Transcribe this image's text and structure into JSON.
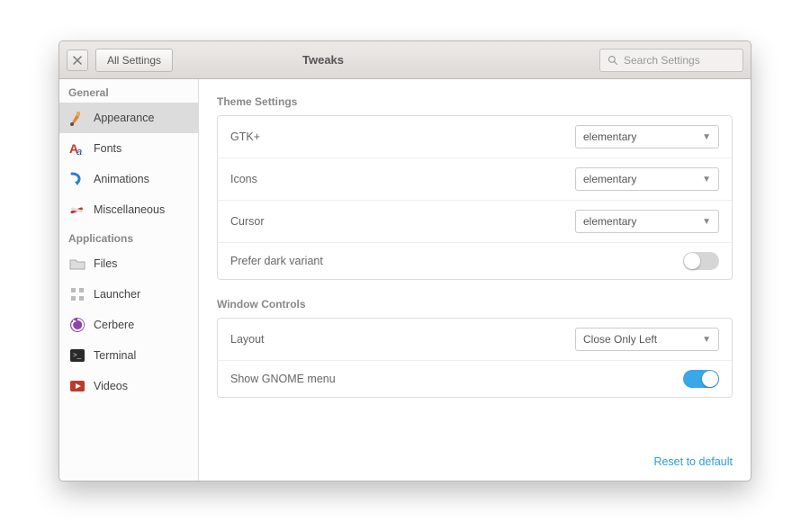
{
  "header": {
    "all_settings": "All Settings",
    "title": "Tweaks",
    "search_placeholder": "Search Settings"
  },
  "sidebar": {
    "groups": [
      {
        "header": "General",
        "items": [
          {
            "label": "Appearance",
            "icon": "appearance",
            "selected": true
          },
          {
            "label": "Fonts",
            "icon": "fonts",
            "selected": false
          },
          {
            "label": "Animations",
            "icon": "animations",
            "selected": false
          },
          {
            "label": "Miscellaneous",
            "icon": "misc",
            "selected": false
          }
        ]
      },
      {
        "header": "Applications",
        "items": [
          {
            "label": "Files",
            "icon": "files",
            "selected": false
          },
          {
            "label": "Launcher",
            "icon": "launcher",
            "selected": false
          },
          {
            "label": "Cerbere",
            "icon": "cerbere",
            "selected": false
          },
          {
            "label": "Terminal",
            "icon": "terminal",
            "selected": false
          },
          {
            "label": "Videos",
            "icon": "videos",
            "selected": false
          }
        ]
      }
    ]
  },
  "settings": {
    "theme": {
      "title": "Theme Settings",
      "gtk_label": "GTK+",
      "gtk_value": "elementary",
      "icons_label": "Icons",
      "icons_value": "elementary",
      "cursor_label": "Cursor",
      "cursor_value": "elementary",
      "dark_label": "Prefer dark variant",
      "dark_on": false
    },
    "window": {
      "title": "Window Controls",
      "layout_label": "Layout",
      "layout_value": "Close Only Left",
      "gnome_label": "Show GNOME menu",
      "gnome_on": true
    }
  },
  "reset_label": "Reset to default"
}
